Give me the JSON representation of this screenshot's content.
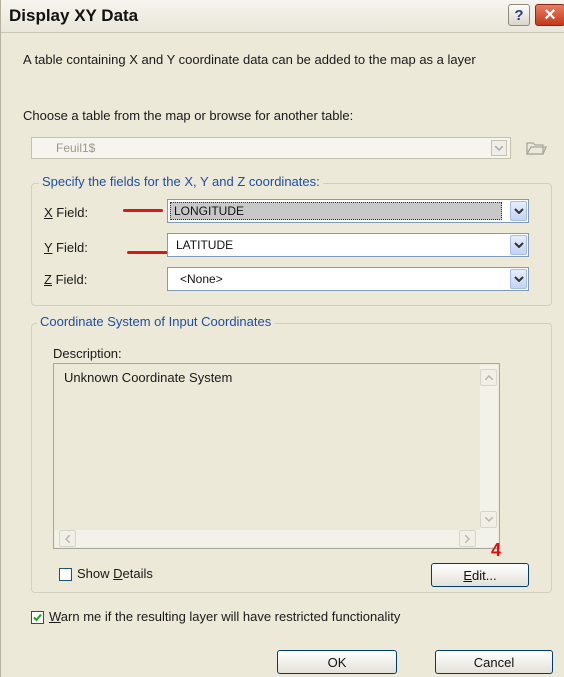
{
  "window": {
    "title": "Display XY Data",
    "help_glyph": "?",
    "close_glyph": "×"
  },
  "intro_text": "A table containing X and Y coordinate data can be added to the map as a layer",
  "table_chooser": {
    "label": "Choose a table from the map or browse for another table:",
    "value": "Feuil1$",
    "browse_icon": "folder-open-icon"
  },
  "fields_group": {
    "label": "Specify the fields for the X, Y and Z coordinates:",
    "x": {
      "label_key": "X",
      "label_rest": " Field:",
      "value": "LONGITUDE"
    },
    "y": {
      "label_key": "Y",
      "label_rest": " Field:",
      "value": "LATITUDE"
    },
    "z": {
      "label_key": "Z",
      "label_rest": " Field:",
      "value": "<None>"
    }
  },
  "coord_group": {
    "label": "Coordinate System of Input Coordinates",
    "description_label": "Description:",
    "description_text": "Unknown Coordinate System",
    "show_details_pre": "Show ",
    "show_details_key": "D",
    "show_details_post": "etails",
    "show_details_checked": false,
    "edit_key": "E",
    "edit_rest": "dit...",
    "annotation": "4"
  },
  "warn": {
    "checked": true,
    "key": "W",
    "rest": "arn me if the resulting layer will have restricted functionality"
  },
  "buttons": {
    "ok": "OK",
    "cancel": "Cancel"
  },
  "colors": {
    "accent_red": "#d11a1a",
    "group_label_blue": "#1e4ea1"
  }
}
